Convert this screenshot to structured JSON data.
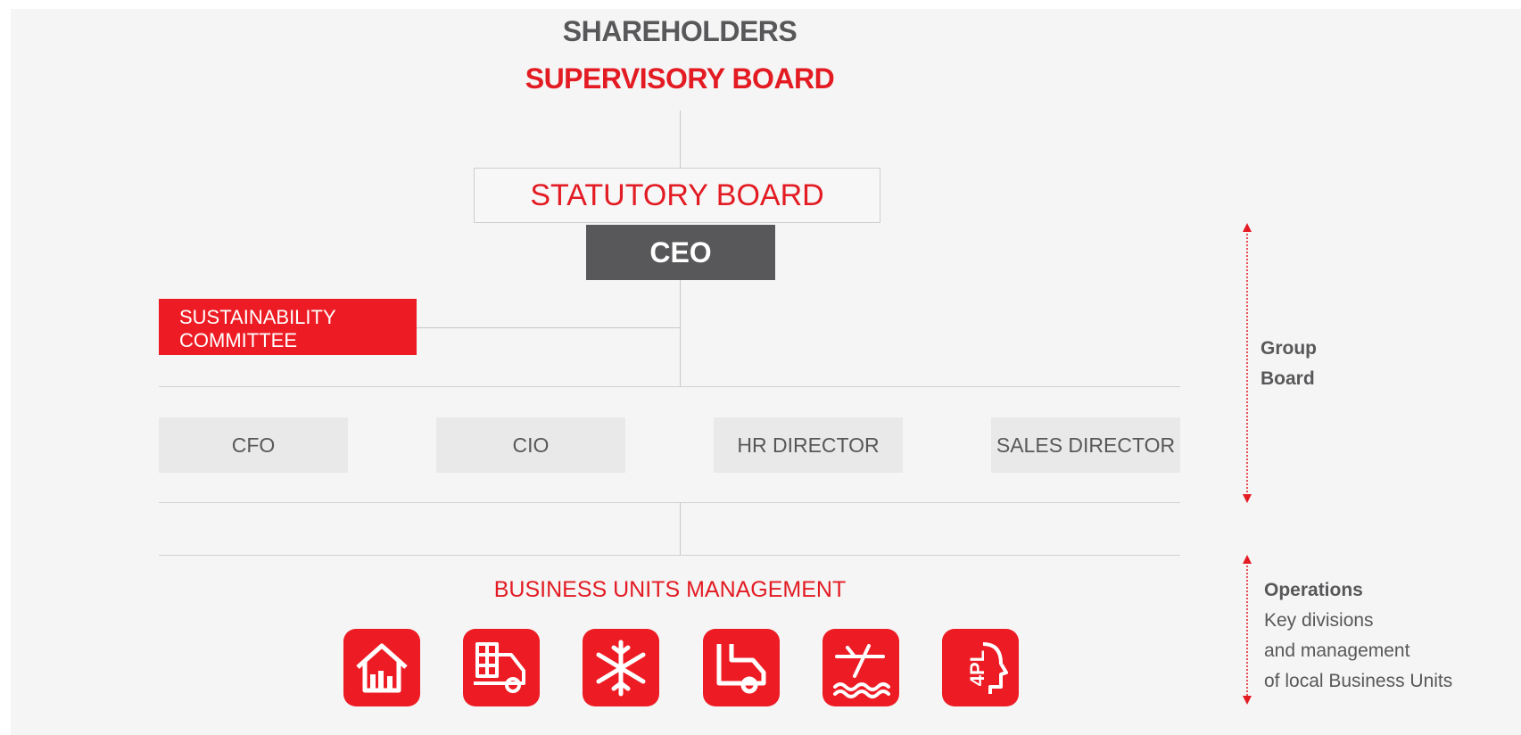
{
  "shareholders": "SHAREHOLDERS",
  "supervisory_board": "SUPERVISORY BOARD",
  "statutory_board": "STATUTORY BOARD",
  "ceo": "CEO",
  "sustainability_committee": {
    "line1": "SUSTAINABILITY",
    "line2": "COMMITTEE"
  },
  "directors": [
    "CFO",
    "CIO",
    "HR DIRECTOR",
    "SALES DIRECTOR"
  ],
  "business_units_management": "BUSINESS UNITS MANAGEMENT",
  "business_unit_icons": [
    "warehouse-icon",
    "container-truck-icon",
    "snowflake-icon",
    "delivery-truck-icon",
    "airplane-ship-icon",
    "4pl-icon"
  ],
  "icon_4pl_text": "4PL",
  "group_board": {
    "line1": "Group",
    "line2": "Board"
  },
  "operations": {
    "title": "Operations",
    "line1": "Key divisions",
    "line2": "and management",
    "line3": "of local Business Units"
  },
  "colors": {
    "brand_red": "#e31b23",
    "dark_gray": "#58585a",
    "light_box": "#e9e9e9",
    "background": "#f5f5f5"
  }
}
